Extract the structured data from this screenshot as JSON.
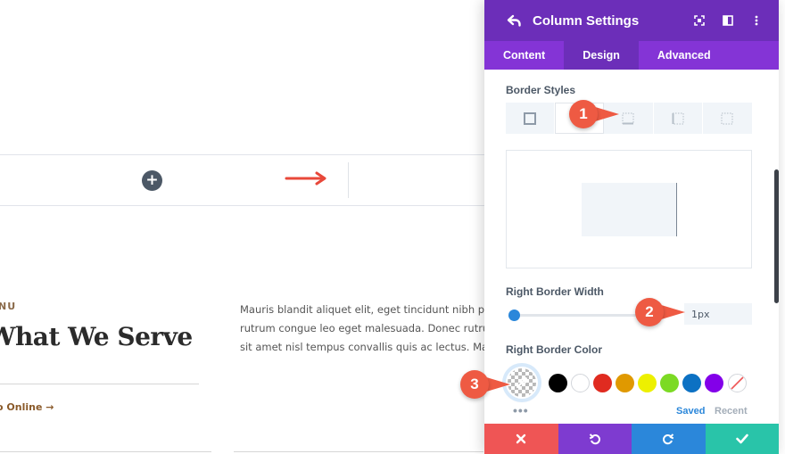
{
  "page": {
    "eyebrow": "NU",
    "heading": "What We Serve",
    "link": "o Online →",
    "paragraph_lines": [
      "Mauris blandit aliquet elit, eget tincidunt nibh pulvinar",
      "rutrum congue leo eget malesuada. Donec rutrum c",
      "sit amet nisl tempus convallis quis ac lectus. Mauris"
    ]
  },
  "panel": {
    "title": "Column Settings",
    "tabs": [
      {
        "label": "Content",
        "active": false
      },
      {
        "label": "Design",
        "active": true
      },
      {
        "label": "Advanced",
        "active": false
      }
    ],
    "border_styles_label": "Border Styles",
    "border_style_options": [
      "all",
      "right",
      "top",
      "bottom",
      "left"
    ],
    "selected_border_style": "right",
    "right_border_width_label": "Right Border Width",
    "right_border_width_value": "1px",
    "right_border_width_slider": 0.0,
    "right_border_color_label": "Right Border Color",
    "palette": [
      "#000000",
      "#ffffff",
      "#e02b20",
      "#e09900",
      "#edf000",
      "#7cda24",
      "#0c71c3",
      "#8300e9"
    ],
    "palette_tabs": [
      "Saved",
      "Recent"
    ],
    "active_palette_tab": "Saved",
    "more_label": "•••"
  },
  "footer": {
    "colors": [
      "#ef5555",
      "#7e3bd0",
      "#2b87da",
      "#29c4a9"
    ],
    "actions": [
      "discard",
      "undo",
      "redo",
      "save"
    ]
  },
  "callouts": [
    "1",
    "2",
    "3"
  ],
  "colors": {
    "header": "#6c2eb9",
    "tabs": "#8434d6",
    "accent_blue": "#2b87da",
    "callout": "#ee5a43"
  }
}
